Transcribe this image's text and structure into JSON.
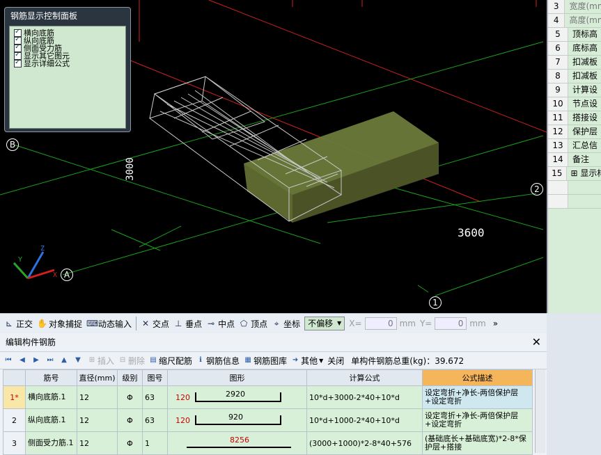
{
  "viewport": {
    "panel_title": "钢筋显示控制面板",
    "checkboxes": [
      "横向底筋",
      "纵向底筋",
      "侧面受力筋",
      "显示其它图元",
      "显示详细公式"
    ],
    "dim_vertical": "3000",
    "dim_horizontal": "3600",
    "axis_labels": {
      "b": "B",
      "a": "A",
      "two": "2",
      "one": "1"
    },
    "gizmo": {
      "z": "Z",
      "y": "Y",
      "x": "X"
    }
  },
  "props": [
    {
      "num": "3",
      "name": "宽度(mm)",
      "dim": true
    },
    {
      "num": "4",
      "name": "高度(mm)",
      "dim": true
    },
    {
      "num": "5",
      "name": "顶标高",
      "dim": false
    },
    {
      "num": "6",
      "name": "底标高",
      "dim": false
    },
    {
      "num": "7",
      "name": "扣减板",
      "dim": false
    },
    {
      "num": "8",
      "name": "扣减板",
      "dim": false
    },
    {
      "num": "9",
      "name": "计算设",
      "dim": false
    },
    {
      "num": "10",
      "name": "节点设",
      "dim": false
    },
    {
      "num": "11",
      "name": "搭接设",
      "dim": false
    },
    {
      "num": "12",
      "name": "保护层",
      "dim": false
    },
    {
      "num": "13",
      "name": "汇总信",
      "dim": false
    },
    {
      "num": "14",
      "name": "备注",
      "dim": false
    },
    {
      "num": "15",
      "name": "⊞ 显示样",
      "dim": true
    }
  ],
  "snapbar": {
    "ortho": "正交",
    "obj_snap": "对象捕捉",
    "dyn_input": "动态输入",
    "intersect": "交点",
    "perp": "垂点",
    "mid": "中点",
    "vertex": "顶点",
    "coord": "坐标",
    "offset_select": "不偏移",
    "x_label": "X=",
    "x_val": "0",
    "y_label": "Y=",
    "y_val": "0",
    "unit": "mm"
  },
  "editor": {
    "title": "编辑构件钢筋",
    "close": "✕",
    "tools": {
      "insert": "插入",
      "delete": "删除",
      "scale": "缩尺配筋",
      "info": "钢筋信息",
      "lib": "钢筋图库",
      "other": "其他",
      "close": "关闭"
    },
    "weight_label": "单构件钢筋总重(kg)：39.672",
    "columns": [
      "",
      "筋号",
      "直径(mm)",
      "级别",
      "图号",
      "图形",
      "计算公式",
      "公式描述"
    ],
    "rows": [
      {
        "idx": "1*",
        "name": "横向底筋.1",
        "dia": "12",
        "grade": "Φ",
        "fig": "63",
        "hook": "120",
        "len": "2920",
        "formula": "10*d+3000-2*40+10*d",
        "desc": "设定弯折+净长-两倍保护层+设定弯折"
      },
      {
        "idx": "2",
        "name": "纵向底筋.1",
        "dia": "12",
        "grade": "Φ",
        "fig": "63",
        "hook": "120",
        "len": "920",
        "formula": "10*d+1000-2*40+10*d",
        "desc": "设定弯折+净长-两倍保护层+设定弯折"
      },
      {
        "idx": "3",
        "name": "侧面受力筋.1",
        "dia": "12",
        "grade": "Φ",
        "fig": "1",
        "hook": "",
        "len": "8256",
        "formula": "(3000+1000)*2-8*40+576",
        "desc": "(基础底长+基础底宽)*2-8*保护层+搭接"
      }
    ]
  }
}
